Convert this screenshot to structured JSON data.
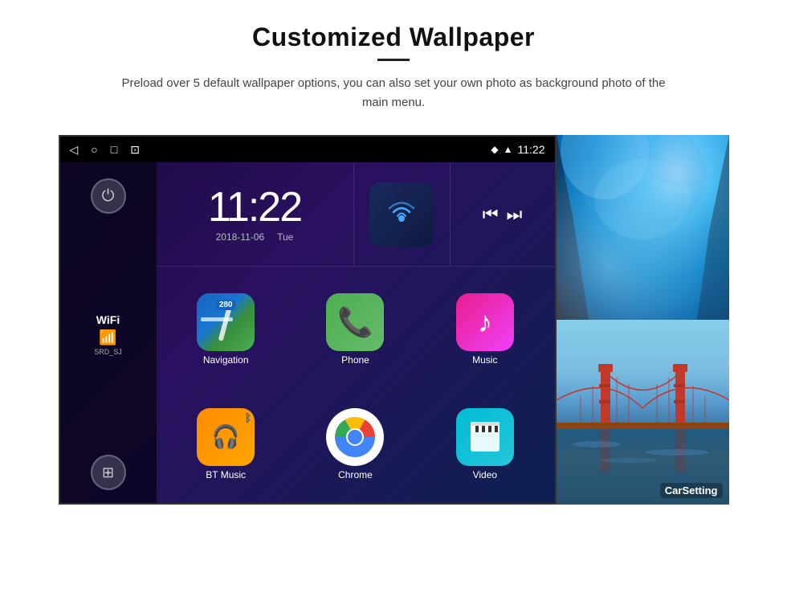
{
  "header": {
    "title": "Customized Wallpaper",
    "divider": true,
    "subtitle": "Preload over 5 default wallpaper options, you can also set your own photo as background photo of the main menu."
  },
  "android": {
    "status_bar": {
      "time": "11:22",
      "back_icon": "◁",
      "home_icon": "○",
      "recent_icon": "□",
      "screenshot_icon": "⊡",
      "location_icon": "♦",
      "signal_icon": "▲"
    },
    "clock": {
      "time": "11:22",
      "date": "2018-11-06",
      "day": "Tue"
    },
    "wifi": {
      "label": "WiFi",
      "network": "SRD_SJ"
    },
    "apps": [
      {
        "id": "navigation",
        "label": "Navigation",
        "icon_type": "navigation"
      },
      {
        "id": "phone",
        "label": "Phone",
        "icon_type": "phone"
      },
      {
        "id": "music",
        "label": "Music",
        "icon_type": "music"
      },
      {
        "id": "bt_music",
        "label": "BT Music",
        "icon_type": "bluetooth"
      },
      {
        "id": "chrome",
        "label": "Chrome",
        "icon_type": "chrome"
      },
      {
        "id": "video",
        "label": "Video",
        "icon_type": "video"
      }
    ]
  },
  "wallpapers": {
    "top": {
      "alt": "Ice cave wallpaper"
    },
    "bottom": {
      "label": "CarSetting",
      "alt": "Golden Gate Bridge wallpaper"
    }
  },
  "colors": {
    "accent": "#e91e8c",
    "bg": "#fff",
    "android_bg": "#1a0a3c"
  }
}
